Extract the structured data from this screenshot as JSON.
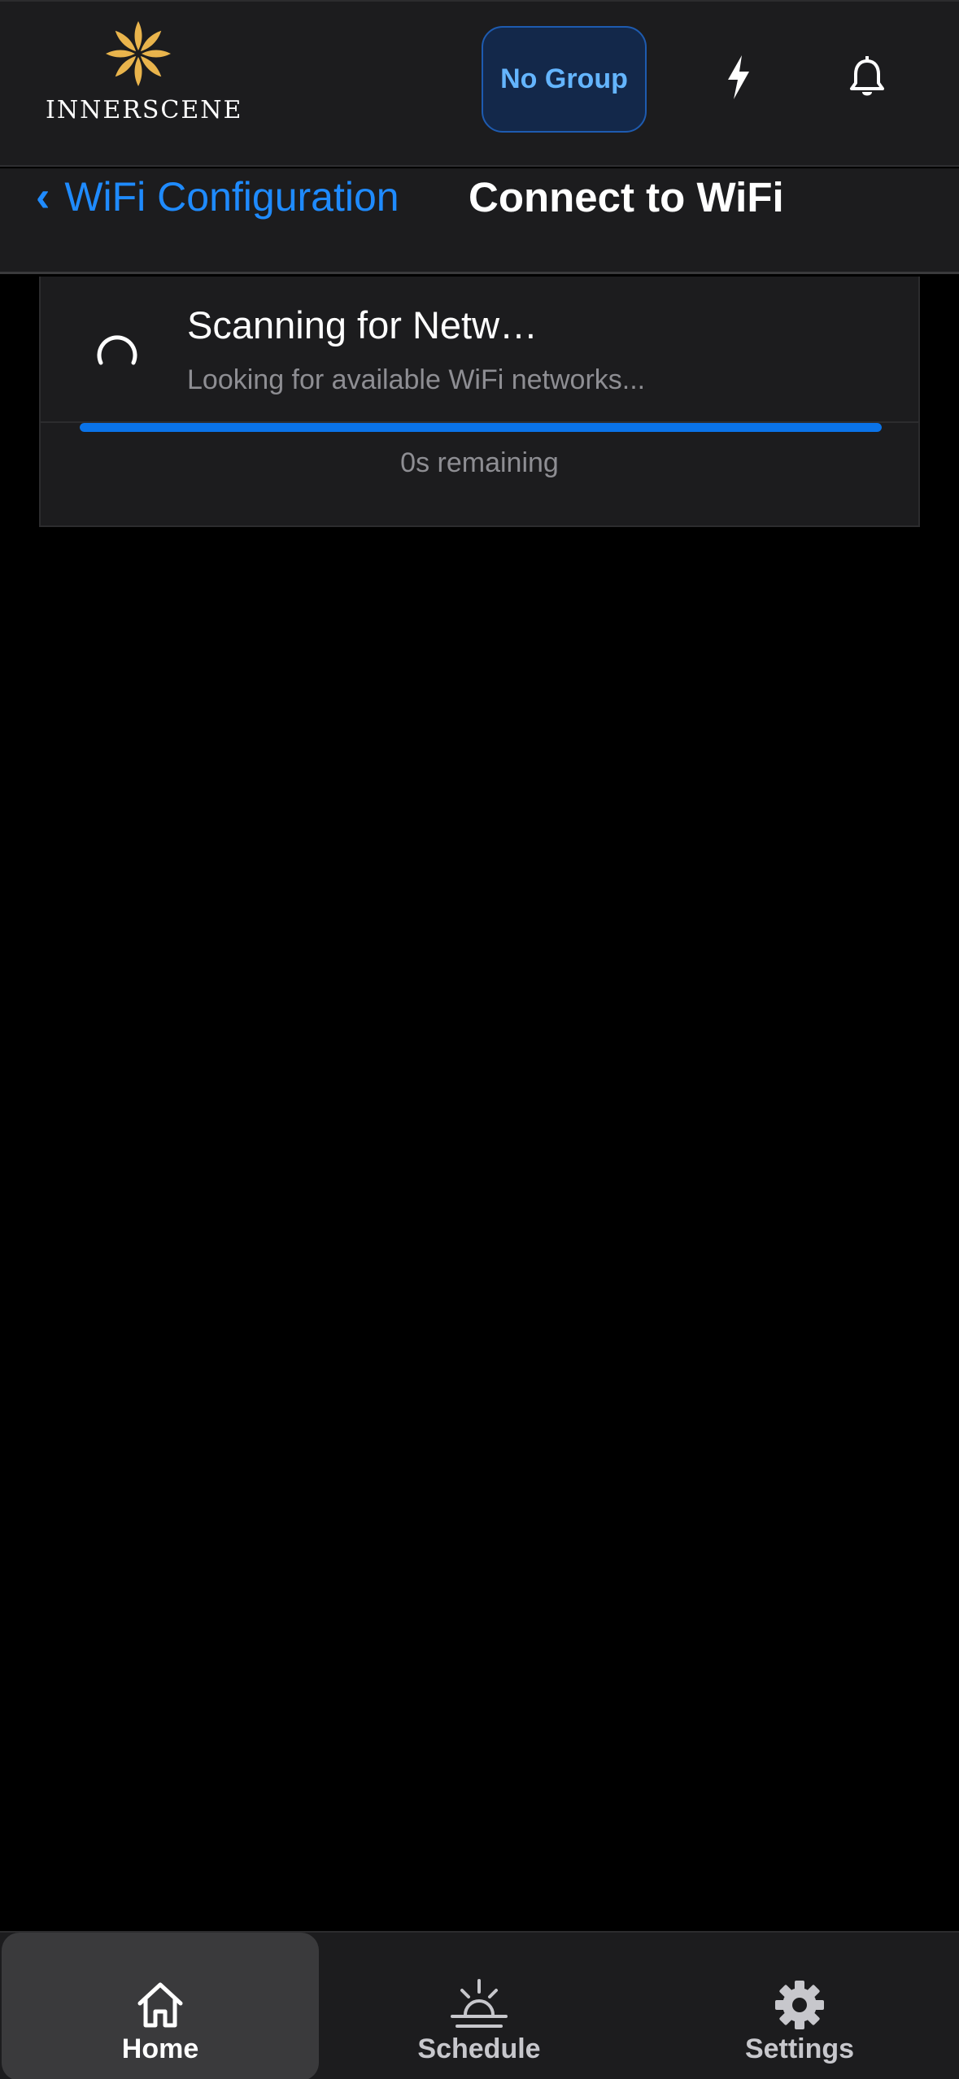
{
  "header": {
    "brand": "INNERSCENE",
    "group_button": "No Group",
    "icons": [
      "innerscene-logo-icon",
      "lightning-icon",
      "bell-icon"
    ],
    "colors": {
      "logo_gold": "#e9b44c",
      "accent_blue": "#1f8bff"
    }
  },
  "nav": {
    "back_label": "WiFi Configuration",
    "back_icon": "chevron-left-icon",
    "title": "Connect to WiFi"
  },
  "scan": {
    "title": "Scanning for Netw…",
    "subtitle": "Looking for available WiFi networks...",
    "progress_percent": 100,
    "remaining": "0s remaining",
    "icon": "spinner-icon"
  },
  "tabs": [
    {
      "label": "Home",
      "icon": "home-icon",
      "active": true
    },
    {
      "label": "Schedule",
      "icon": "sunrise-icon",
      "active": false
    },
    {
      "label": "Settings",
      "icon": "gear-icon",
      "active": false
    }
  ]
}
